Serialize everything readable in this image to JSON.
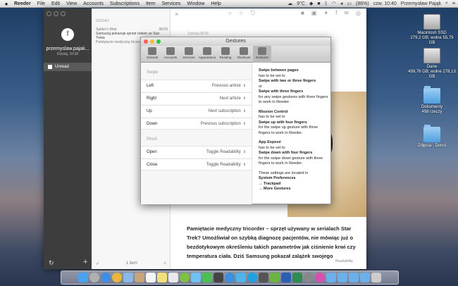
{
  "menubar": {
    "app_name": "Reeder",
    "items": [
      "File",
      "Edit",
      "View",
      "Accounts",
      "Subscriptions",
      "Item",
      "Services",
      "Window",
      "Help"
    ],
    "temperature": "9°C",
    "battery": "(86%)",
    "clock": "czw. 10:40",
    "user": "Przemysław Pająk"
  },
  "desktop": {
    "icons": [
      {
        "label": "Macintosh SSD",
        "sub": "279,2 GB; wolne 55,79 GB"
      },
      {
        "label": "Dane",
        "sub": "499,76 GB; wolne 278,13 GB"
      },
      {
        "label": "Dokumenty",
        "sub": "458 rzeczy"
      },
      {
        "label": "Zdjęcia · Dunst",
        "sub": ""
      }
    ]
  },
  "reeder": {
    "username": "przemyslaw.pajak...",
    "user_date": "Dzisiaj, 10:39",
    "unread_label": "Unread",
    "list_header": "DZISIAJ",
    "items": [
      {
        "source": "Spider's Web",
        "time": "08:59",
        "title": "Samsung pokazuje sprzęt rodem ze Star Treka",
        "snippet": "Pamiętacie medyczny tricorder..."
      }
    ],
    "item_count": "1 item",
    "article_date": "Dzisiaj 08:59",
    "article_text": "Pamiętacie medyczny tricorder – sprzęt używany w serialach Star Trek? Umożliwiał on szybką diagnozę pacjentów, nie mówiąc już o bezdotykowym określeniu takich parametrów jak ciśnienie krwi czy temperatura ciała. Dziś Samsung pokazał zalążek swojego",
    "readability_label": "Readability"
  },
  "prefs": {
    "title": "Gestures",
    "tabs": [
      "General",
      "Accounts",
      "Services",
      "Appearance",
      "Reading",
      "Shortcuts",
      "Gestures"
    ],
    "swipe_header": "Swipe",
    "pinch_header": "Pinch",
    "swipe_rows": [
      {
        "label": "Left",
        "value": "Previous article"
      },
      {
        "label": "Right",
        "value": "Next article"
      },
      {
        "label": "Up",
        "value": "Next subscription"
      },
      {
        "label": "Down",
        "value": "Previous subscription"
      }
    ],
    "pinch_rows": [
      {
        "label": "Open",
        "value": "Toggle Readability"
      },
      {
        "label": "Close",
        "value": "Toggle Readability"
      }
    ],
    "help": {
      "p1_title": "Swipe between pages",
      "p1_a": "has to be set to",
      "p1_b": "Swipe with two or three fingers",
      "p1_c": "or",
      "p1_d": "Swipe with three fingers",
      "p1_e": "for any swipe gestures with three fingers to work in Reeder.",
      "p2_title": "Mission Control",
      "p2_a": "has to be set to",
      "p2_b": "Swipe up with four fingers",
      "p2_c": "for the swipe up gesture with three fingers to work in Reeder.",
      "p3_title": "App Exposé",
      "p3_a": "has to be set to",
      "p3_b": "Swipe down with four fingers",
      "p3_c": "for the swipe down gesture with three fingers to work in Reeder.",
      "p4_a": "These settings are located in",
      "p4_b": "System Preferences",
      "p4_c": "→ Trackpad",
      "p4_d": "→ More Gestures"
    }
  },
  "colors": {
    "sidebar": "#3d3d3d",
    "close": "#fc5d57",
    "minimize": "#fdbb2f",
    "zoom": "#28c840"
  }
}
